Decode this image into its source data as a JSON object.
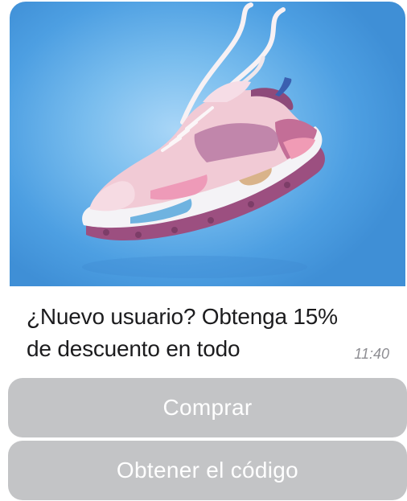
{
  "message": {
    "text_line1": "¿Nuevo usuario? Obtenga 15%",
    "text_line2": "de descuento en todo",
    "time": "11:40"
  },
  "buttons": {
    "buy_label": "Comprar",
    "code_label": "Obtener el código"
  },
  "colors": {
    "hero_background": "#4d9fe2",
    "button_background": "#c3c4c6",
    "button_text": "#ffffff",
    "shoe_pink": "#f2c7d3",
    "shoe_purple": "#9a4c7f"
  }
}
